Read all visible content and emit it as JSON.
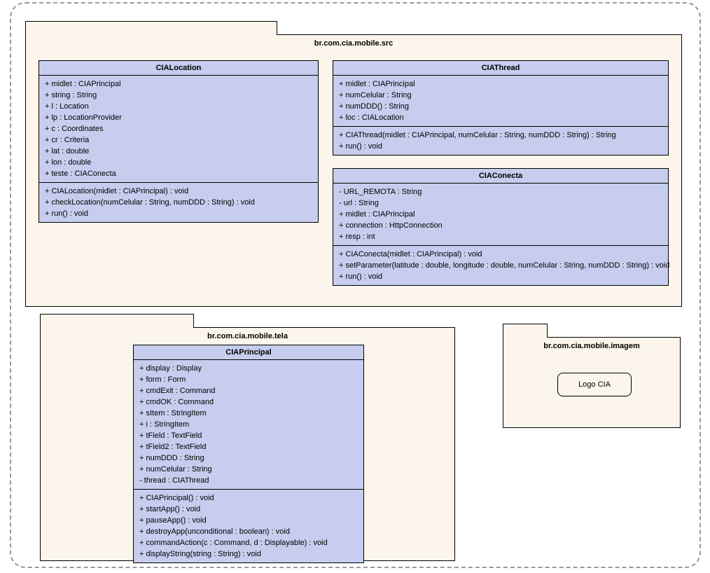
{
  "packages": {
    "src": {
      "title": "br.com.cia.mobile.src",
      "classes": {
        "cialocation": {
          "title": "CIALocation",
          "attrs": [
            "+ midlet : CIAPrincipal",
            "+ string : String",
            "+ l : Location",
            "+ lp : LocationProvider",
            "+ c : Coordinates",
            "+ cr : Criteria",
            "+ lat : double",
            "+ lon : double",
            "+ teste : CIAConecta"
          ],
          "ops": [
            "+ CIALocation(midlet : CIAPrincipal) : void",
            "+ checkLocation(numCelular : String, numDDD : String) : void",
            "+ run() : void"
          ]
        },
        "ciathread": {
          "title": "CIAThread",
          "attrs": [
            "+ midlet : CIAPrincipal",
            "+ numCelular : String",
            "+ numDDD() : String",
            "+ loc : CIALocation"
          ],
          "ops": [
            "+ CIAThread(midlet : CIAPrincipal, numCelular : String, numDDD : String) : String",
            "+ run() : void"
          ]
        },
        "ciaconecta": {
          "title": "CIAConecta",
          "attrs": [
            "- URL_REMOTA : String",
            "- url : String",
            "+ midlet : CIAPrincipal",
            "+ connection : HttpConnection",
            "+ resp : int"
          ],
          "ops": [
            "+ CIAConecta(midlet : CIAPrincipal) : void",
            "+ setParameter(latitude : double, longitude : double, numCelular : String, numDDD : String) : void",
            "+ run() : void"
          ]
        }
      }
    },
    "tela": {
      "title": "br.com.cia.mobile.tela",
      "classes": {
        "ciaprincipal": {
          "title": "CIAPrincipal",
          "attrs": [
            "+ display : Display",
            "+ form : Form",
            "+ cmdExit : Command",
            "+ cmdOK : Command",
            "+ sItem : StringItem",
            "+ i : StringItem",
            "+ tField : TextField",
            "+ tField2 : TextField",
            "+ numDDD : String",
            "+ numCelular : String",
            "- thread : CIAThread"
          ],
          "ops": [
            "+ CIAPrincipal() : void",
            "+ startApp() : void",
            "+ pauseApp() : void",
            "+ destroyApp(unconditional : boolean) : void",
            "+ commandAction(c : Command, d : Displayable) : void",
            "+ displayString(string : String) : void"
          ]
        }
      }
    },
    "imagem": {
      "title": "br.com.cia.mobile.imagem",
      "artifact": "Logo CIA"
    }
  }
}
